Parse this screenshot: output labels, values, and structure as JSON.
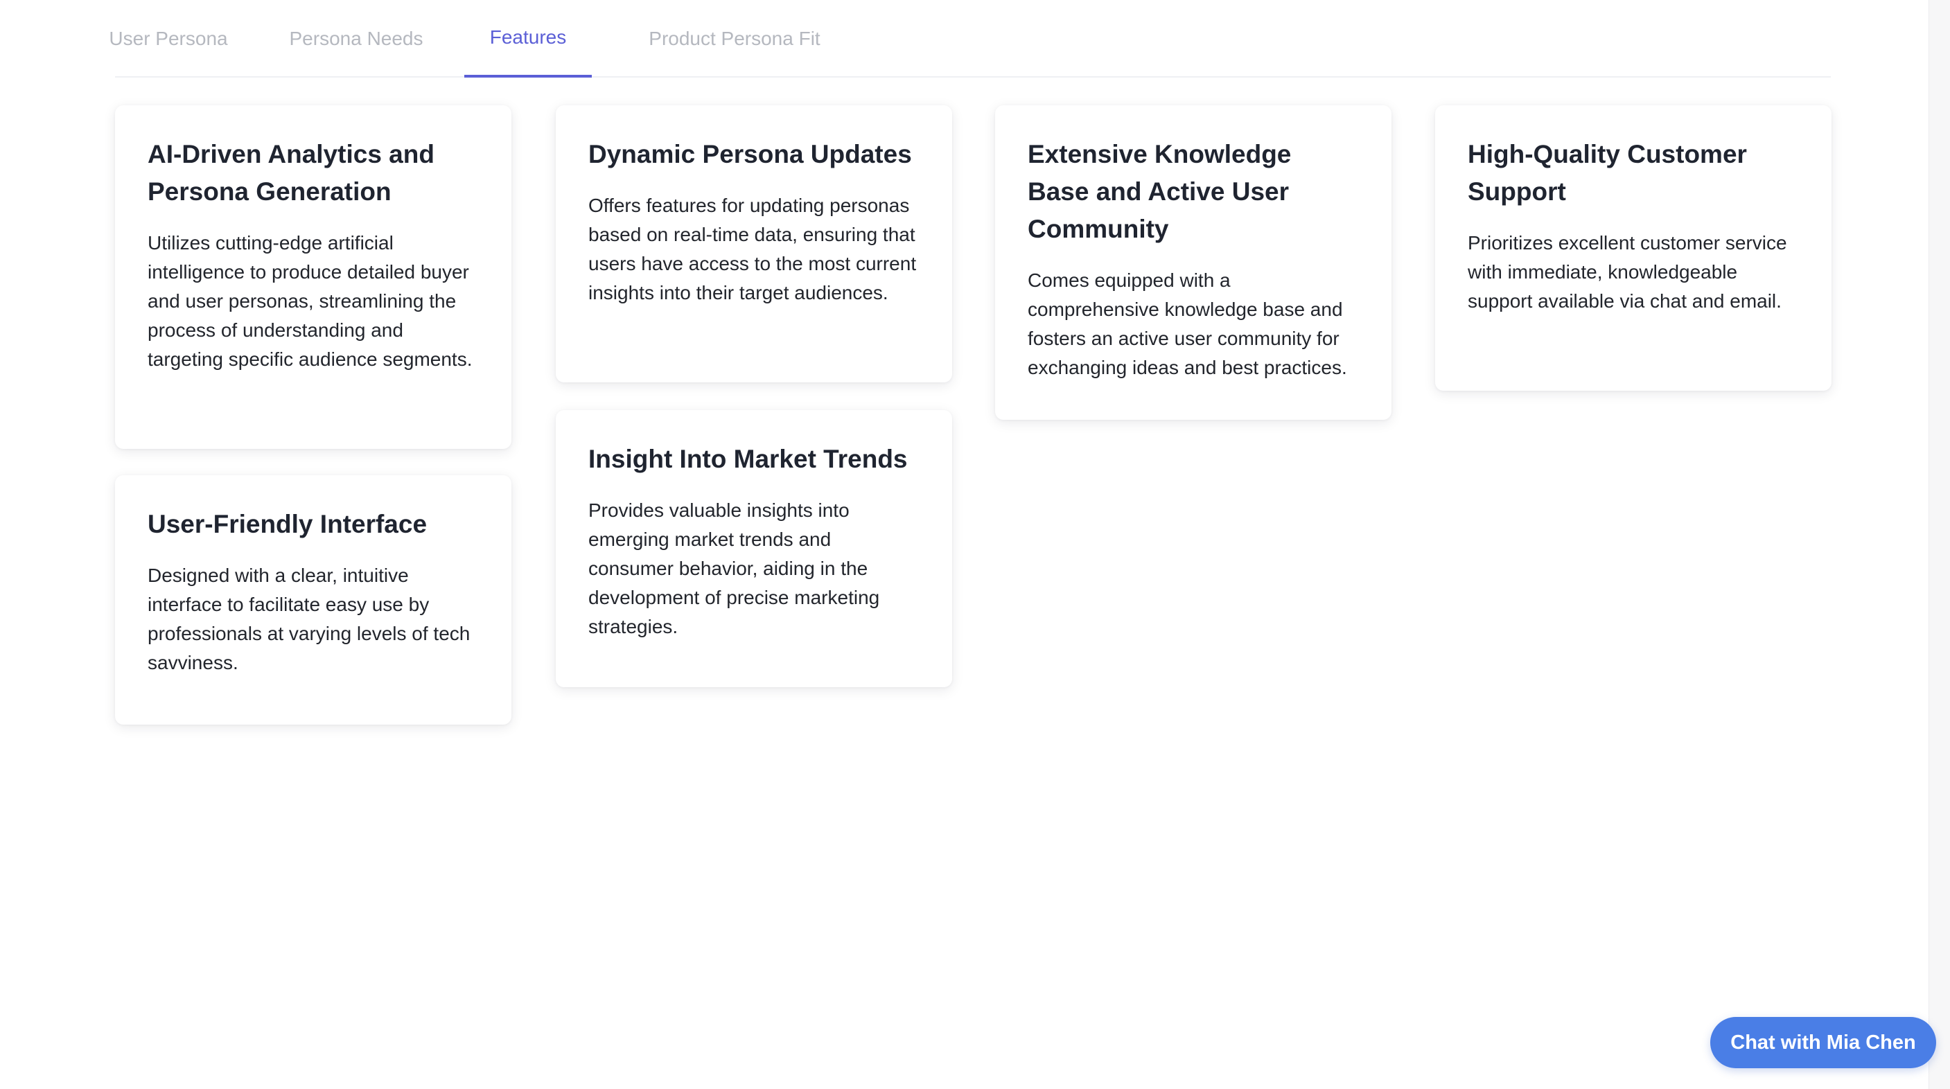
{
  "tabs": [
    {
      "label": "User Persona",
      "active": false
    },
    {
      "label": "Persona Needs",
      "active": false
    },
    {
      "label": "Features",
      "active": true
    },
    {
      "label": "Product Persona Fit",
      "active": false
    }
  ],
  "features": [
    {
      "title": "AI-Driven Analytics and Persona Generation",
      "description": "Utilizes cutting-edge artificial intelligence to produce detailed buyer and user personas, streamlining the process of understanding and targeting specific audience segments."
    },
    {
      "title": "Dynamic Persona Updates",
      "description": "Offers features for updating personas based on real-time data, ensuring that users have access to the most current insights into their target audiences."
    },
    {
      "title": "Extensive Knowledge Base and Active User Community",
      "description": "Comes equipped with a comprehensive knowledge base and fosters an active user community for exchanging ideas and best practices."
    },
    {
      "title": "High-Quality Customer Support",
      "description": "Prioritizes excellent customer service with immediate, knowledgeable support available via chat and email."
    },
    {
      "title": "User-Friendly Interface",
      "description": "Designed with a clear, intuitive interface to facilitate easy use by professionals at varying levels of tech savviness."
    },
    {
      "title": "Insight Into Market Trends",
      "description": "Provides valuable insights into emerging market trends and consumer behavior, aiding in the development of precise marketing strategies."
    }
  ],
  "chat": {
    "label": "Chat with Mia Chen"
  },
  "colors": {
    "accent": "#5b5fd6",
    "chat_button": "#4a7ee6",
    "inactive_tab": "#b5b8bf",
    "title_text": "#1f2430"
  }
}
